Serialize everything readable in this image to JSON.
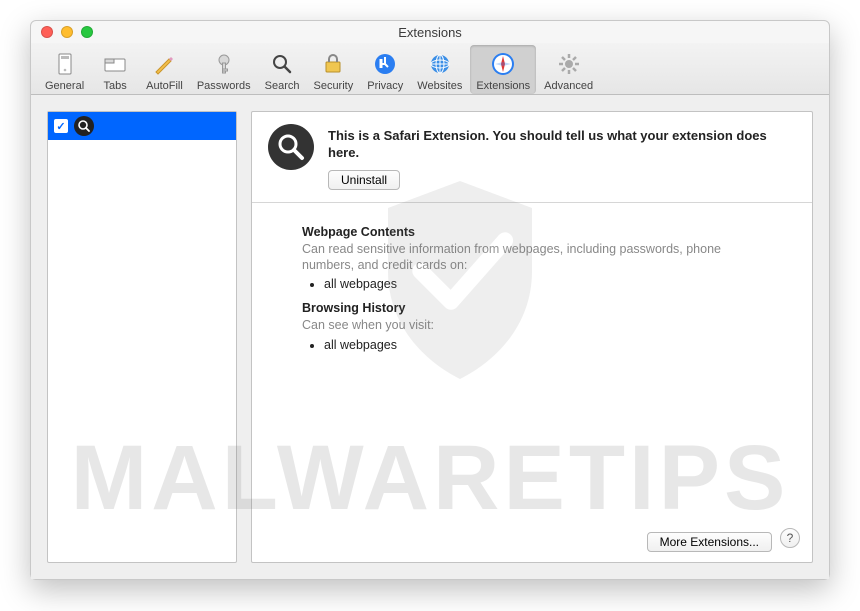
{
  "window": {
    "title": "Extensions"
  },
  "toolbar": {
    "items": [
      {
        "label": "General"
      },
      {
        "label": "Tabs"
      },
      {
        "label": "AutoFill"
      },
      {
        "label": "Passwords"
      },
      {
        "label": "Search"
      },
      {
        "label": "Security"
      },
      {
        "label": "Privacy"
      },
      {
        "label": "Websites"
      },
      {
        "label": "Extensions"
      },
      {
        "label": "Advanced"
      }
    ]
  },
  "sidebar": {
    "selected": {
      "checked": true
    }
  },
  "detail": {
    "description": "This is a Safari Extension. You should tell us what your extension does here.",
    "uninstall_label": "Uninstall",
    "perms": {
      "webpage_heading": "Webpage Contents",
      "webpage_sub": "Can read sensitive information from webpages, including passwords, phone numbers, and credit cards on:",
      "webpage_item": "all webpages",
      "history_heading": "Browsing History",
      "history_sub": "Can see when you visit:",
      "history_item": "all webpages"
    },
    "more_label": "More Extensions...",
    "help_label": "?"
  },
  "watermark": "MALWARETIPS"
}
